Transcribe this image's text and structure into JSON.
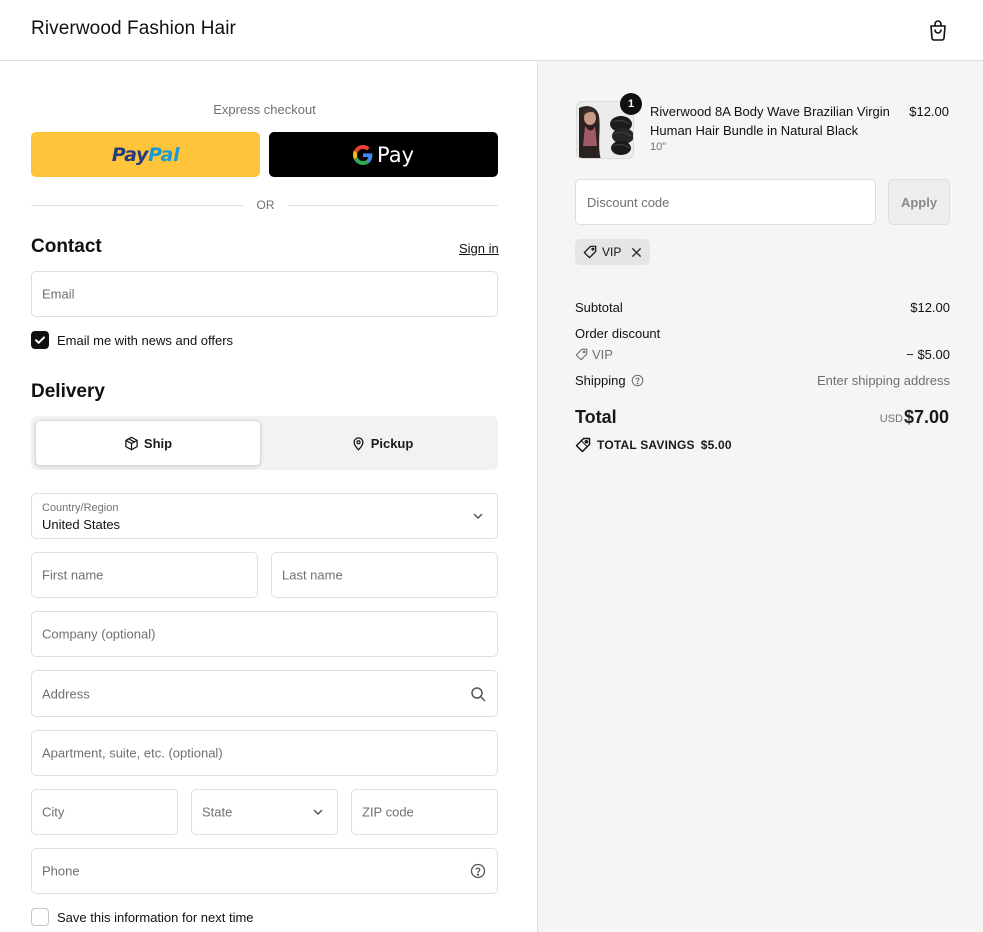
{
  "header": {
    "brand": "Riverwood Fashion Hair"
  },
  "express": {
    "label": "Express checkout",
    "paypal_part1": "Pay",
    "paypal_part2": "Pal",
    "gpay_label": "Pay",
    "or_text": "OR"
  },
  "contact": {
    "title": "Contact",
    "sign_in": "Sign in",
    "email_placeholder": "Email",
    "newsletter_label": "Email me with news and offers",
    "newsletter_checked": true
  },
  "delivery": {
    "title": "Delivery",
    "options": [
      {
        "label": "Ship",
        "icon": "package-icon",
        "selected": true
      },
      {
        "label": "Pickup",
        "icon": "location-pin-icon",
        "selected": false
      }
    ],
    "country_label": "Country/Region",
    "country_value": "United States",
    "first_name_placeholder": "First name",
    "last_name_placeholder": "Last name",
    "company_placeholder": "Company (optional)",
    "address_placeholder": "Address",
    "apartment_placeholder": "Apartment, suite, etc. (optional)",
    "city_placeholder": "City",
    "state_placeholder": "State",
    "zip_placeholder": "ZIP code",
    "phone_placeholder": "Phone",
    "save_info_label": "Save this information for next time",
    "save_info_checked": false
  },
  "order": {
    "product": {
      "name": "Riverwood 8A Body Wave Brazilian Virgin Human Hair Bundle in Natural Black",
      "variant": "10\"",
      "price": "$12.00",
      "quantity": "1"
    },
    "discount_placeholder": "Discount code",
    "apply_label": "Apply",
    "applied_code": "VIP",
    "subtotal_label": "Subtotal",
    "subtotal_value": "$12.00",
    "order_discount_label": "Order discount",
    "discount_code_name": "VIP",
    "discount_value": "− $5.00",
    "shipping_label": "Shipping",
    "shipping_value": "Enter shipping address",
    "total_label": "Total",
    "total_currency": "USD",
    "total_value": "$7.00",
    "savings_label": "TOTAL SAVINGS",
    "savings_value": "$5.00"
  },
  "colors": {
    "paypal_yellow": "#ffc439",
    "paypal_dark": "#253b80",
    "paypal_light": "#179bd7",
    "gpay_black": "#000000",
    "sidebar_bg": "#f5f5f5"
  }
}
